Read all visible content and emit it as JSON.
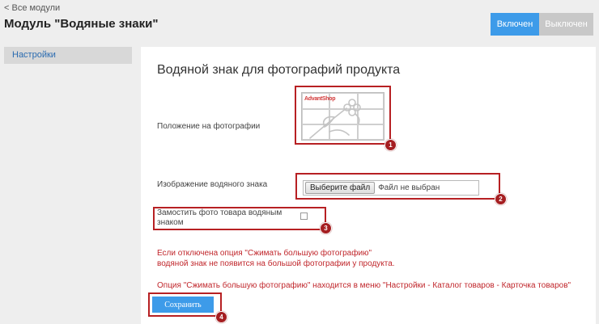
{
  "header": {
    "back_link": "< Все модули",
    "title": "Модуль \"Водяные знаки\"",
    "btn_on": "Включен",
    "btn_off": "Выключен"
  },
  "sidebar": {
    "items": [
      {
        "label": "Настройки"
      }
    ]
  },
  "main": {
    "section_title": "Водяной знак для фотографий продукта",
    "position_label": "Положение на фотографии",
    "watermark_logo": "AdvantShop",
    "image_label": "Изображение водяного знака",
    "file_button": "Выберите файл",
    "file_status": "Файл не выбран",
    "tile_label_line1": "Замостить фото товара водяным",
    "tile_label_line2": "знаком",
    "note_line1": "Если отключена опция \"Сжимать большую фотографию\"",
    "note_line2": "водяной знак не появится на большой фотографии у продукта.",
    "note_line3": "Опция \"Сжимать большую фотографию\" находится в меню \"Настройки - Каталог товаров - Карточка товаров\"",
    "save_button": "Сохранить"
  },
  "annotations": [
    "1",
    "2",
    "3",
    "4"
  ],
  "colors": {
    "primary_blue": "#3d9be9",
    "disabled_gray": "#c8c8c8",
    "annotation_red": "#b72023",
    "note_red": "#c0262b"
  },
  "icons": [
    "flower-watermark-icon"
  ]
}
